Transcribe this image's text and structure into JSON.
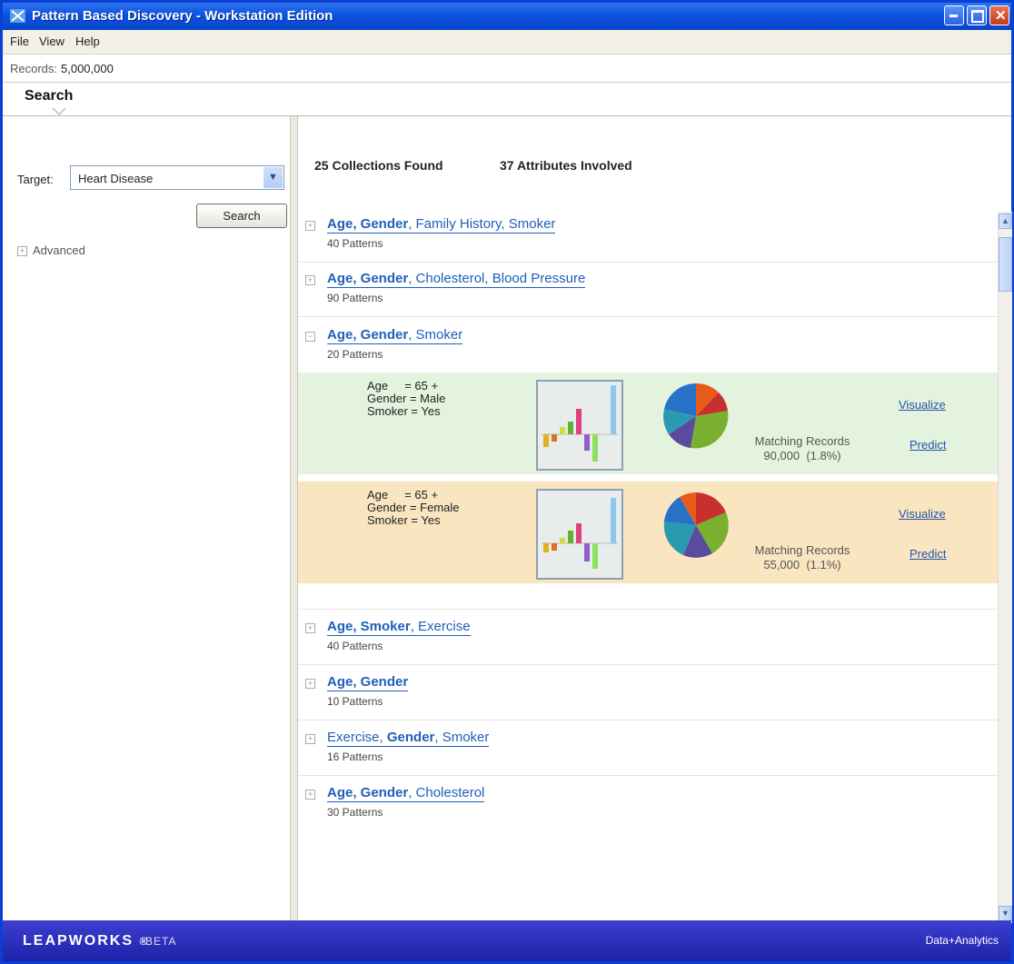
{
  "window": {
    "title": "Pattern Based Discovery - Workstation Edition"
  },
  "menu": [
    "File",
    "View",
    "Help"
  ],
  "records": {
    "label": "Records:",
    "value": "5,000,000"
  },
  "tab": {
    "label": "Search"
  },
  "left": {
    "target_label": "Target:",
    "target_value": "Heart Disease",
    "search_button": "Search",
    "advanced_label": "Advanced"
  },
  "summary": {
    "collections": "25 Collections Found",
    "attributes": "37 Attributes Involved"
  },
  "collections": [
    {
      "bold": "Age, Gender",
      "rest": ", Family History, Smoker",
      "count": "40 Patterns",
      "expanded": false
    },
    {
      "bold": "Age, Gender",
      "rest": ", Cholesterol, Blood Pressure",
      "count": "90 Patterns",
      "expanded": false
    },
    {
      "bold": "Age, Gender",
      "rest": ", Smoker",
      "count": "20 Patterns",
      "expanded": true
    },
    {
      "bold": "Age, Smoker",
      "rest": ", Exercise",
      "count": "40 Patterns",
      "expanded": false
    },
    {
      "bold": "Age, Gender",
      "rest": "",
      "count": "10 Patterns",
      "expanded": false
    },
    {
      "pre": "Exercise, ",
      "bold": "Gender",
      "rest": ", Smoker",
      "count": "16 Patterns",
      "expanded": false
    },
    {
      "bold": "Age, Gender",
      "rest": ", Cholesterol",
      "count": "30 Patterns",
      "expanded": false
    }
  ],
  "patterns": [
    {
      "cond1": "Age     = 65 +",
      "cond2": "Gender = Male",
      "cond3": "Smoker = Yes",
      "matching_label": "Matching Records",
      "matching_value": "90,000  (1.8%)",
      "visualize": "Visualize",
      "predict": "Predict",
      "background": "#e4f3dd"
    },
    {
      "cond1": "Age     = 65 +",
      "cond2": "Gender = Female",
      "cond3": "Smoker = Yes",
      "matching_label": "Matching Records",
      "matching_value": "55,000  (1.1%)",
      "visualize": "Visualize",
      "predict": "Predict",
      "background": "#fae5c1"
    }
  ],
  "footer": {
    "logo": "LEAPWORKS",
    "reg": "®",
    "beta": "BETA",
    "right": "Data+Analytics"
  },
  "colors": {
    "link": "#1f5fb8",
    "titlebar": "#0b52e0",
    "footer": "#2a2fbe"
  }
}
